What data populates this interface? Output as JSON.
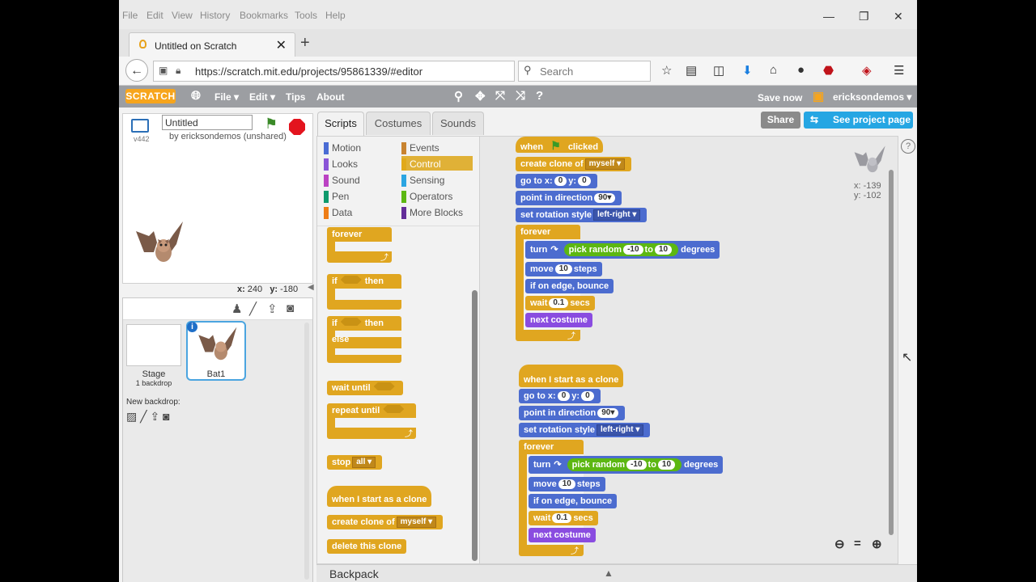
{
  "browser": {
    "menu": [
      "File",
      "Edit",
      "View",
      "History",
      "Bookmarks",
      "Tools",
      "Help"
    ],
    "tab_title": "Untitled on Scratch",
    "url": "https://scratch.mit.edu/projects/95861339/#editor",
    "search_placeholder": "Search"
  },
  "scratch": {
    "logo": "SCRATCH",
    "menu": {
      "file": "File ▾",
      "edit": "Edit ▾",
      "tips": "Tips",
      "about": "About"
    },
    "save_now": "Save now",
    "username": "ericksondemos ▾",
    "share": "Share",
    "see_project": "See project page",
    "version": "v442",
    "project_title": "Untitled",
    "by_line": "by ericksondemos (unshared)",
    "stage_x_label": "x:",
    "stage_x": "240",
    "stage_y_label": "y:",
    "stage_y": "-180",
    "stage_label": "Stage",
    "stage_backdrops": "1 backdrop",
    "new_backdrop": "New backdrop:",
    "sprite_name": "Bat1",
    "sprite_x": "x: -139",
    "sprite_y": "y: -102"
  },
  "tabs": {
    "scripts": "Scripts",
    "costumes": "Costumes",
    "sounds": "Sounds"
  },
  "categories": {
    "motion": "Motion",
    "looks": "Looks",
    "sound": "Sound",
    "pen": "Pen",
    "data": "Data",
    "events": "Events",
    "control": "Control",
    "sensing": "Sensing",
    "operators": "Operators",
    "more": "More Blocks"
  },
  "category_colors": {
    "motion": "#4a6cd4",
    "looks": "#8a55d7",
    "sound": "#bb42c3",
    "pen": "#0e9a6c",
    "data": "#ee7d16",
    "events": "#c88330",
    "control": "#e1a91a",
    "sensing": "#2ca5e2",
    "operators": "#5cb712",
    "more": "#632d99"
  },
  "palette": {
    "forever": "forever",
    "if": "if",
    "then": "then",
    "if2": "if",
    "then2": "then",
    "else": "else",
    "wait_until": "wait until",
    "repeat_until": "repeat until",
    "stop": "stop",
    "stop_opt": "all ▾",
    "when_clone": "when I start as a clone",
    "create_clone": "create clone of",
    "create_opt": "myself ▾",
    "delete_clone": "delete this clone"
  },
  "script1": {
    "when": "when",
    "clicked": "clicked",
    "create": "create clone of",
    "create_opt": "myself ▾",
    "goto": "go to x:",
    "gx": "0",
    "gy_label": "y:",
    "gy": "0",
    "point": "point in direction",
    "dir": "90▾",
    "rot": "set rotation style",
    "rot_opt": "left-right ▾",
    "forever": "forever",
    "turn": "turn",
    "pick": "pick random",
    "from": "-10",
    "to": "to",
    "tov": "10",
    "degrees": "degrees",
    "move": "move",
    "steps_v": "10",
    "steps": "steps",
    "bounce": "if on edge, bounce",
    "wait": "wait",
    "secs_v": "0.1",
    "secs": "secs",
    "next": "next costume"
  },
  "script2": {
    "hat": "when I start as a clone",
    "goto": "go to x:",
    "gx": "0",
    "gy_label": "y:",
    "gy": "0",
    "point": "point in direction",
    "dir": "90▾",
    "rot": "set rotation style",
    "rot_opt": "left-right ▾",
    "forever": "forever",
    "turn": "turn",
    "pick": "pick random",
    "from": "-10",
    "to": "to",
    "tov": "10",
    "degrees": "degrees",
    "move": "move",
    "steps_v": "10",
    "steps": "steps",
    "bounce": "if on edge, bounce",
    "wait": "wait",
    "secs_v": "0.1",
    "secs": "secs",
    "next": "next costume"
  },
  "backpack": "Backpack"
}
